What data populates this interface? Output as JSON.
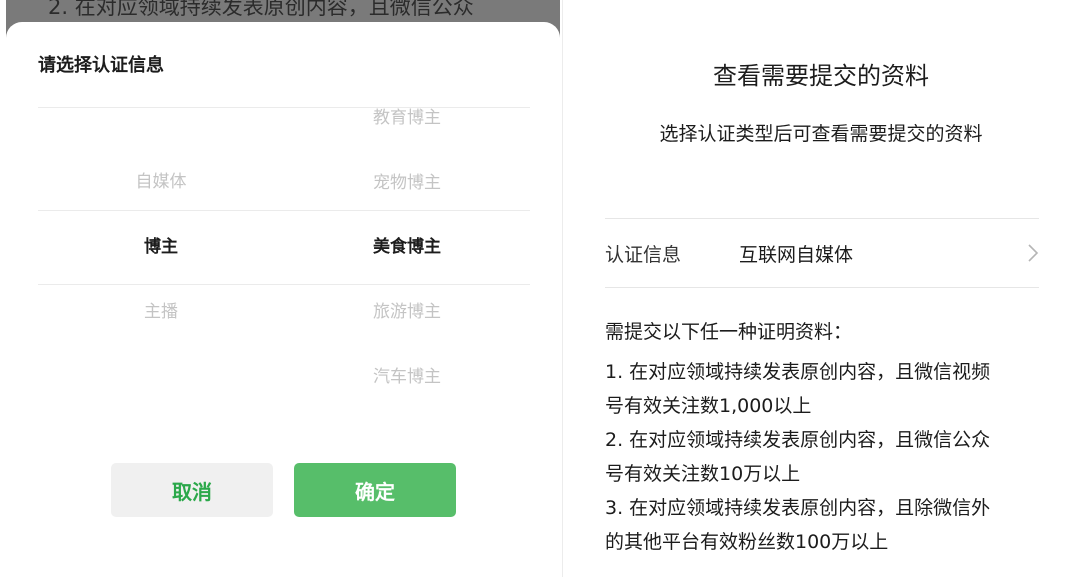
{
  "left": {
    "background_text": "2. 在对应领域持续发表原创内容，且微信公众",
    "sheet_title": "请选择认证信息",
    "picker": {
      "left_column": [
        {
          "label": "自媒体",
          "selected": false
        },
        {
          "label": "博主",
          "selected": true
        },
        {
          "label": "主播",
          "selected": false
        }
      ],
      "right_column": [
        {
          "label": "教育博主",
          "selected": false
        },
        {
          "label": "宠物博主",
          "selected": false
        },
        {
          "label": "美食博主",
          "selected": true
        },
        {
          "label": "旅游博主",
          "selected": false
        },
        {
          "label": "汽车博主",
          "selected": false
        }
      ]
    },
    "cancel_label": "取消",
    "confirm_label": "确定"
  },
  "right": {
    "title": "查看需要提交的资料",
    "subtitle": "选择认证类型后可查看需要提交的资料",
    "cert_label": "认证信息",
    "cert_value": "互联网自媒体",
    "requirements_heading": "需提交以下任一种证明资料：",
    "requirements": [
      "1. 在对应领域持续发表原创内容，且微信视频\n号有效关注数1,000以上",
      "2. 在对应领域持续发表原创内容，且微信公众\n号有效关注数10万以上",
      "3. 在对应领域持续发表原创内容，且除微信外\n的其他平台有效粉丝数100万以上"
    ]
  },
  "colors": {
    "accent_green": "#57be6a",
    "cancel_text_green": "#2ba84a",
    "overlay_gray": "#7a7a7a"
  },
  "icons": {
    "cert_row_chevron": "chevron-right-icon"
  }
}
